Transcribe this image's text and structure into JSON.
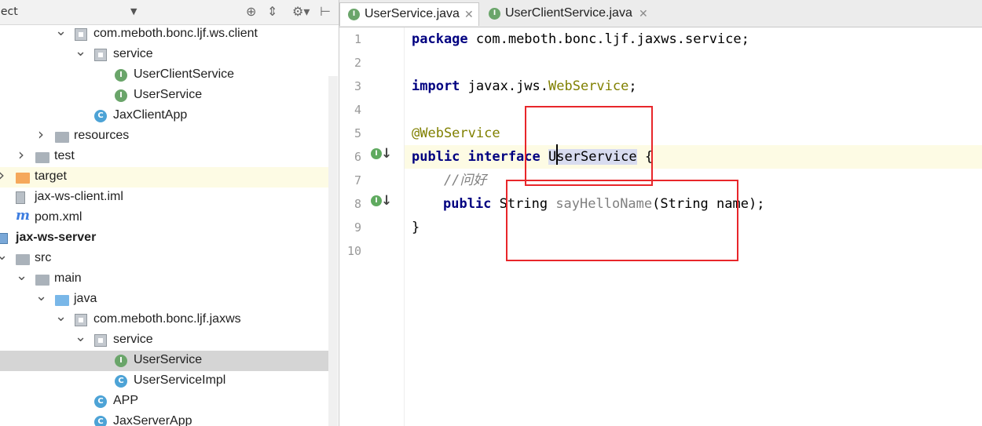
{
  "panel": {
    "title": "ject",
    "dropdown": "▼",
    "toolbar_icons": [
      "crosshair-icon",
      "collapse-icon",
      "gear-icon",
      "hide-panel-icon"
    ]
  },
  "tree": [
    {
      "label": "com.meboth.bonc.ljf.ws.client",
      "icon": "package",
      "arrow": "expanded"
    },
    {
      "label": "service",
      "icon": "package",
      "arrow": "expanded"
    },
    {
      "label": "UserClientService",
      "icon": "interface",
      "glyph": "I"
    },
    {
      "label": "UserService",
      "icon": "interface",
      "glyph": "I"
    },
    {
      "label": "JaxClientApp",
      "icon": "class",
      "glyph": "C"
    },
    {
      "label": "resources",
      "icon": "folder",
      "arrow": "collapsed"
    },
    {
      "label": "test",
      "icon": "folder",
      "arrow": "collapsed"
    },
    {
      "label": "target",
      "icon": "folder-orange",
      "arrow": "collapsed"
    },
    {
      "label": "jax-ws-client.iml",
      "icon": "iml"
    },
    {
      "label": "pom.xml",
      "icon": "maven",
      "glyph": "m"
    },
    {
      "label": "jax-ws-server",
      "icon": "module",
      "bold": true
    },
    {
      "label": "src",
      "icon": "folder",
      "arrow": "expanded"
    },
    {
      "label": "main",
      "icon": "folder",
      "arrow": "expanded"
    },
    {
      "label": "java",
      "icon": "folder-blue",
      "arrow": "expanded"
    },
    {
      "label": "com.meboth.bonc.ljf.jaxws",
      "icon": "package",
      "arrow": "expanded"
    },
    {
      "label": "service",
      "icon": "package",
      "arrow": "expanded"
    },
    {
      "label": "UserService",
      "icon": "interface",
      "glyph": "I",
      "selected": true
    },
    {
      "label": "UserServiceImpl",
      "icon": "class",
      "glyph": "C"
    },
    {
      "label": "APP",
      "icon": "class",
      "glyph": "C"
    },
    {
      "label": "JaxServerApp",
      "icon": "class",
      "glyph": "C"
    }
  ],
  "tabs": [
    {
      "label": "UserService.java",
      "glyph": "I",
      "active": true
    },
    {
      "label": "UserClientService.java",
      "glyph": "I",
      "active": false
    }
  ],
  "editor": {
    "line_numbers": [
      "1",
      "2",
      "3",
      "4",
      "5",
      "6",
      "7",
      "8",
      "9",
      "10"
    ],
    "gutter_glyph": "I",
    "code": {
      "l1_kw": "package",
      "l1_rest": " com.meboth.bonc.ljf.jaxws.service;",
      "l3_kw": "import",
      "l3_a": " javax.jws.",
      "l3_b": "WebService",
      "l3_c": ";",
      "l5": "@WebService",
      "l6_kw": "public interface",
      "l6_sp": " ",
      "l6_name": "UserService",
      "l6_end": " {",
      "l7": "    //问好",
      "l8_kw": "public",
      "l8_a": " String ",
      "l8_m": "sayHelloName",
      "l8_b": "(String name);",
      "l9": "}"
    }
  }
}
